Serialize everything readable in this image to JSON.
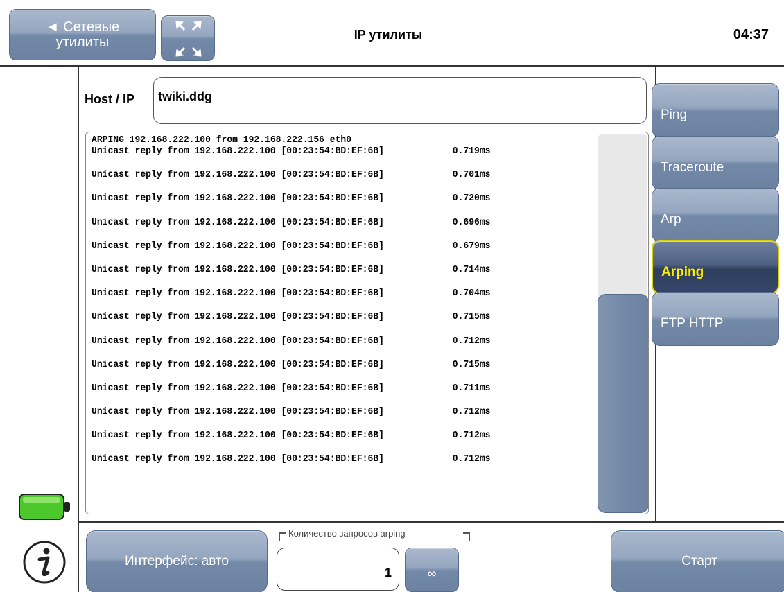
{
  "header": {
    "back_label_line1": "◄ Сетевые",
    "back_label_line2": "утилиты",
    "title": "IP утилиты",
    "time": "04:37"
  },
  "host": {
    "label": "Host / IP",
    "value": "twiki.ddg"
  },
  "output": {
    "header_line": "ARPING 192.168.222.100 from 192.168.222.156 eth0",
    "rows": [
      {
        "text": "Unicast reply from 192.168.222.100 [00:23:54:BD:EF:6B]",
        "time": "0.719ms"
      },
      {
        "text": "Unicast reply from 192.168.222.100 [00:23:54:BD:EF:6B]",
        "time": "0.701ms"
      },
      {
        "text": "Unicast reply from 192.168.222.100 [00:23:54:BD:EF:6B]",
        "time": "0.720ms"
      },
      {
        "text": "Unicast reply from 192.168.222.100 [00:23:54:BD:EF:6B]",
        "time": "0.696ms"
      },
      {
        "text": "Unicast reply from 192.168.222.100 [00:23:54:BD:EF:6B]",
        "time": "0.679ms"
      },
      {
        "text": "Unicast reply from 192.168.222.100 [00:23:54:BD:EF:6B]",
        "time": "0.714ms"
      },
      {
        "text": "Unicast reply from 192.168.222.100 [00:23:54:BD:EF:6B]",
        "time": "0.704ms"
      },
      {
        "text": "Unicast reply from 192.168.222.100 [00:23:54:BD:EF:6B]",
        "time": "0.715ms"
      },
      {
        "text": "Unicast reply from 192.168.222.100 [00:23:54:BD:EF:6B]",
        "time": "0.712ms"
      },
      {
        "text": "Unicast reply from 192.168.222.100 [00:23:54:BD:EF:6B]",
        "time": "0.715ms"
      },
      {
        "text": "Unicast reply from 192.168.222.100 [00:23:54:BD:EF:6B]",
        "time": "0.711ms"
      },
      {
        "text": "Unicast reply from 192.168.222.100 [00:23:54:BD:EF:6B]",
        "time": "0.712ms"
      },
      {
        "text": "Unicast reply from 192.168.222.100 [00:23:54:BD:EF:6B]",
        "time": "0.712ms"
      },
      {
        "text": "Unicast reply from 192.168.222.100 [00:23:54:BD:EF:6B]",
        "time": "0.712ms"
      }
    ]
  },
  "tabs": [
    {
      "label": "Ping",
      "active": false
    },
    {
      "label": "Traceroute",
      "active": false
    },
    {
      "label": "Arp",
      "active": false
    },
    {
      "label": "Arping",
      "active": true
    },
    {
      "label": "FTP HTTP",
      "active": false
    }
  ],
  "bottom": {
    "interface_label": "Интерфейс: авто",
    "count_label": "Количество запросов arping",
    "count_value": "1",
    "infinity_label": "∞",
    "start_label": "Старт"
  },
  "icons": {
    "battery": "battery-icon",
    "info": "info-icon",
    "fullscreen": "fullscreen-icon"
  },
  "colors": {
    "button_blue": "#7d91ae",
    "active_tab_text": "#ffee00",
    "battery_green": "#4cc82c"
  }
}
